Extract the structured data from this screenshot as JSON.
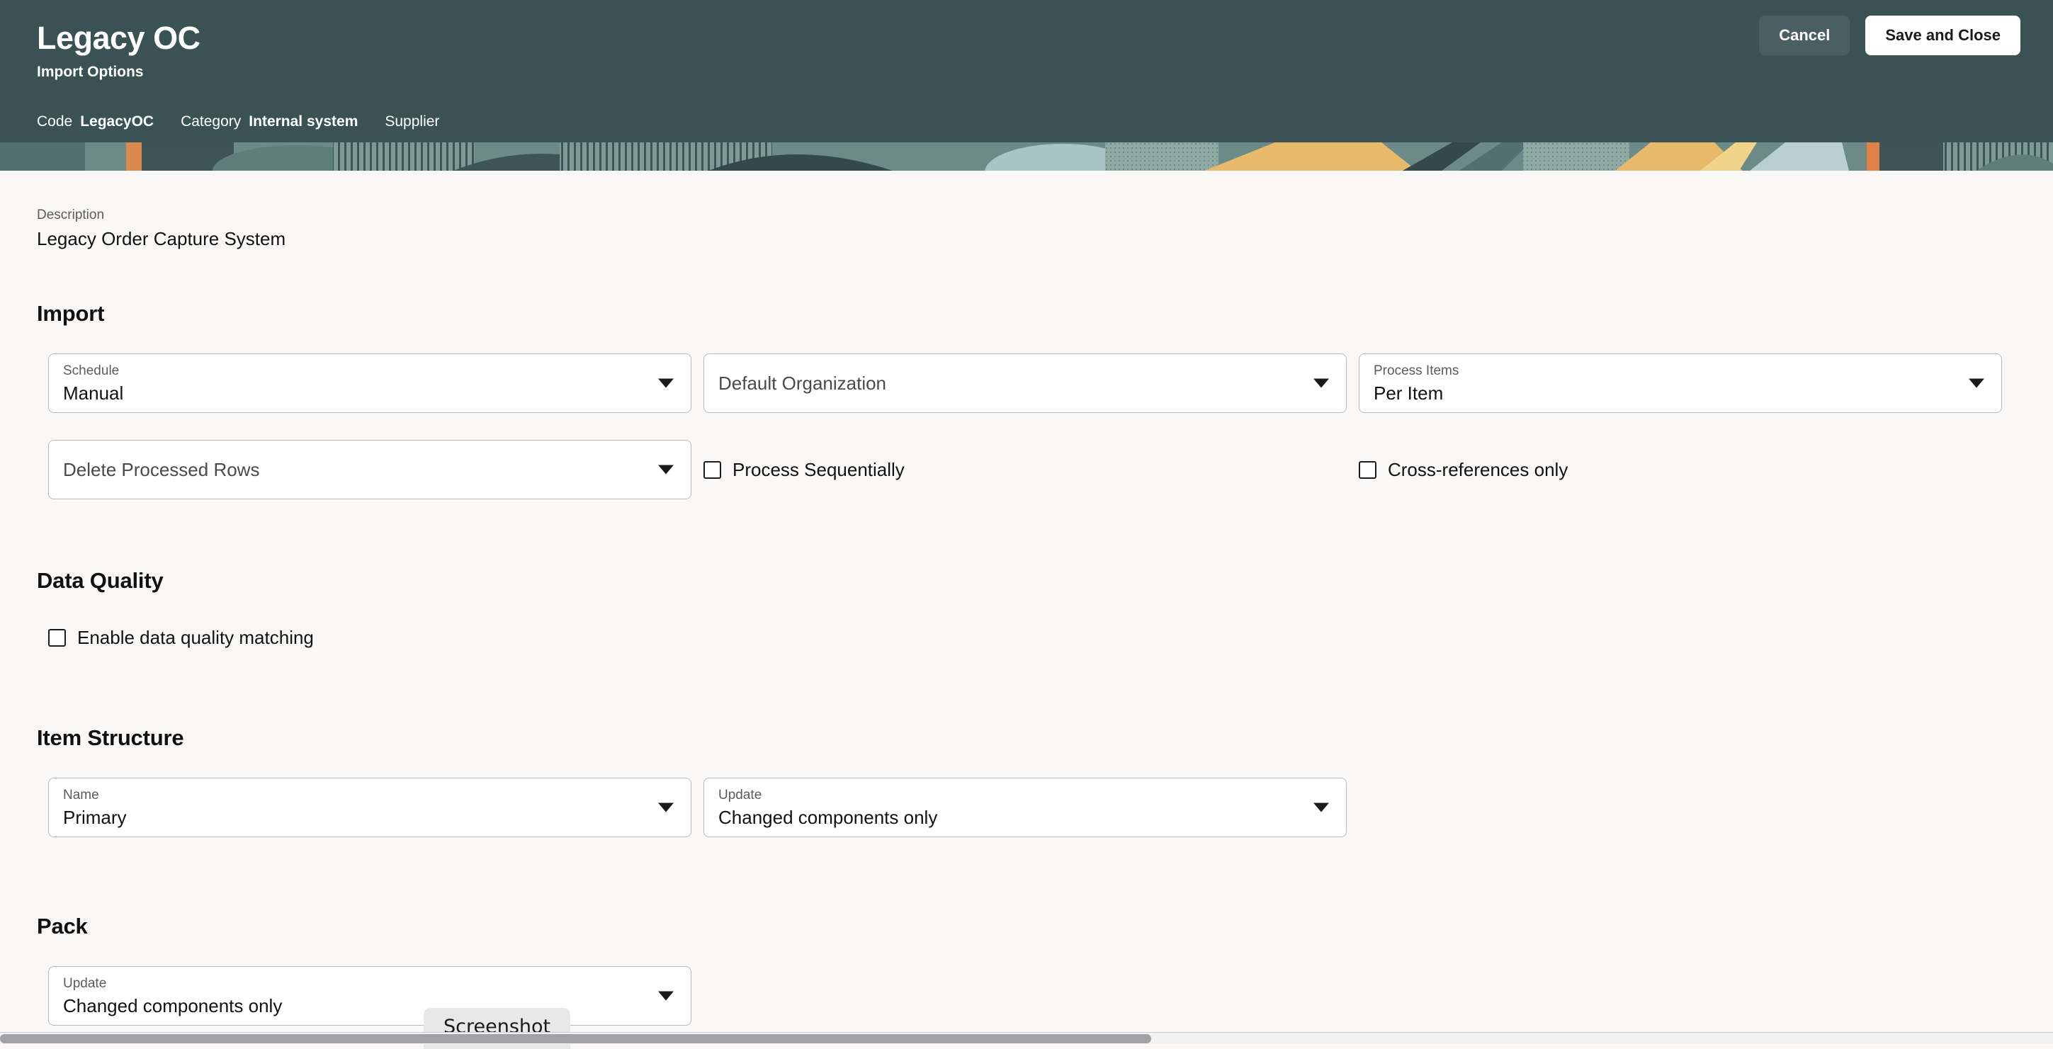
{
  "header": {
    "title": "Legacy OC",
    "subtitle": "Import Options",
    "meta": {
      "code_label": "Code",
      "code_value": "LegacyOC",
      "category_label": "Category",
      "category_value": "Internal system",
      "supplier_label": "Supplier"
    },
    "cancel_label": "Cancel",
    "save_label": "Save and Close",
    "bg_color": "#3a5254",
    "cancel_bg_color": "#4a5f61"
  },
  "description": {
    "label": "Description",
    "value": "Legacy Order Capture System"
  },
  "sections": {
    "import": {
      "title": "Import",
      "schedule": {
        "label": "Schedule",
        "value": "Manual",
        "icon": "chevron-down-icon"
      },
      "default_organization": {
        "label": "Default Organization",
        "value": "",
        "placeholder": "Default Organization",
        "icon": "chevron-down-icon"
      },
      "process_items": {
        "label": "Process Items",
        "value": "Per Item",
        "icon": "chevron-down-icon"
      },
      "delete_processed_rows": {
        "label": "Delete Processed Rows",
        "value": "",
        "placeholder": "Delete Processed Rows",
        "icon": "chevron-down-icon"
      },
      "process_sequentially": {
        "label": "Process Sequentially",
        "checked": false
      },
      "cross_references_only": {
        "label": "Cross-references only",
        "checked": false
      }
    },
    "data_quality": {
      "title": "Data Quality",
      "enable_matching": {
        "label": "Enable data quality matching",
        "checked": false
      }
    },
    "item_structure": {
      "title": "Item Structure",
      "name": {
        "label": "Name",
        "value": "Primary",
        "icon": "chevron-down-icon"
      },
      "update": {
        "label": "Update",
        "value": "Changed components only",
        "icon": "chevron-down-icon"
      }
    },
    "pack": {
      "title": "Pack",
      "update": {
        "label": "Update",
        "value": "Changed components only",
        "icon": "chevron-down-icon"
      }
    }
  },
  "overlay": {
    "screenshot_chip": "Screenshot"
  }
}
